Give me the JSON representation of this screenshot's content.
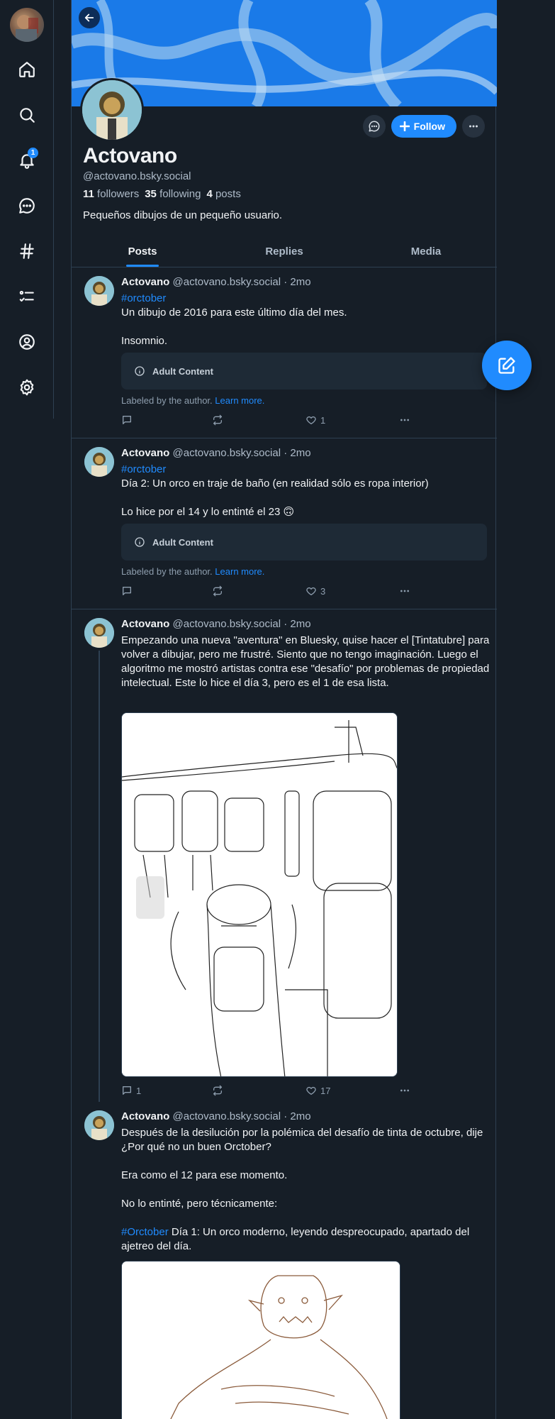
{
  "colors": {
    "accent": "#208bfe",
    "background": "#161e27",
    "border": "#2e4052",
    "muted_text": "#aebbc9"
  },
  "nav": {
    "items": [
      {
        "icon": "home-icon"
      },
      {
        "icon": "search-icon"
      },
      {
        "icon": "bell-icon",
        "badge": "1"
      },
      {
        "icon": "chat-icon"
      },
      {
        "icon": "hashtag-icon"
      },
      {
        "icon": "list-icon"
      },
      {
        "icon": "profile-icon"
      },
      {
        "icon": "gear-icon"
      }
    ]
  },
  "profile": {
    "display_name": "Actovano",
    "handle": "@actovano.bsky.social",
    "followers_count": "11",
    "followers_label": "followers",
    "following_count": "35",
    "following_label": "following",
    "posts_count": "4",
    "posts_label": "posts",
    "bio": "Pequeños dibujos de un pequeño usuario.",
    "follow_label": "Follow"
  },
  "tabs": [
    "Posts",
    "Replies",
    "Media"
  ],
  "posts": [
    {
      "name": "Actovano",
      "handle_time": "@actovano.bsky.social · 2mo",
      "hashtag": "#orctober",
      "line1": "Un dibujo de 2016 para este último día del mes.",
      "line2": "Insomnio.",
      "adult_label": "Adult Content",
      "labeled_text": "Labeled by the author.",
      "learn_more": "Learn more.",
      "replies": "",
      "reposts": "",
      "likes": "1"
    },
    {
      "name": "Actovano",
      "handle_time": "@actovano.bsky.social · 2mo",
      "hashtag": "#orctober",
      "line1": "Día 2: Un orco en traje de baño (en realidad sólo es ropa interior)",
      "line2": "Lo hice por el 14 y lo entinté el 23 🙃",
      "adult_label": "Adult Content",
      "labeled_text": "Labeled by the author.",
      "learn_more": "Learn more.",
      "replies": "",
      "reposts": "",
      "likes": "3"
    },
    {
      "name": "Actovano",
      "handle_time": "@actovano.bsky.social · 2mo",
      "text": "Empezando una nueva \"aventura\" en Bluesky, quise hacer el [Tintatubre] para volver a dibujar, pero me frustré. Siento que no tengo imaginación. Luego el algoritmo me mostró artistas contra ese \"desafío\" por problemas de propiedad intelectual. Este lo hice el día 3, pero es el 1 de esa lista.",
      "replies": "1",
      "reposts": "",
      "likes": "17"
    },
    {
      "name": "Actovano",
      "handle_time": "@actovano.bsky.social · 2mo",
      "line1": "Después de la desilución por la polémica del desafío de tinta de octubre, dije ¿Por qué no un buen Orctober?",
      "line2": "Era como el 12 para ese momento.",
      "line3": "No lo entinté, pero técnicamente:",
      "hashtag": "#Orctober",
      "line4": " Día 1: Un orco moderno, leyendo despreocupado, apartado del ajetreo del día."
    }
  ]
}
